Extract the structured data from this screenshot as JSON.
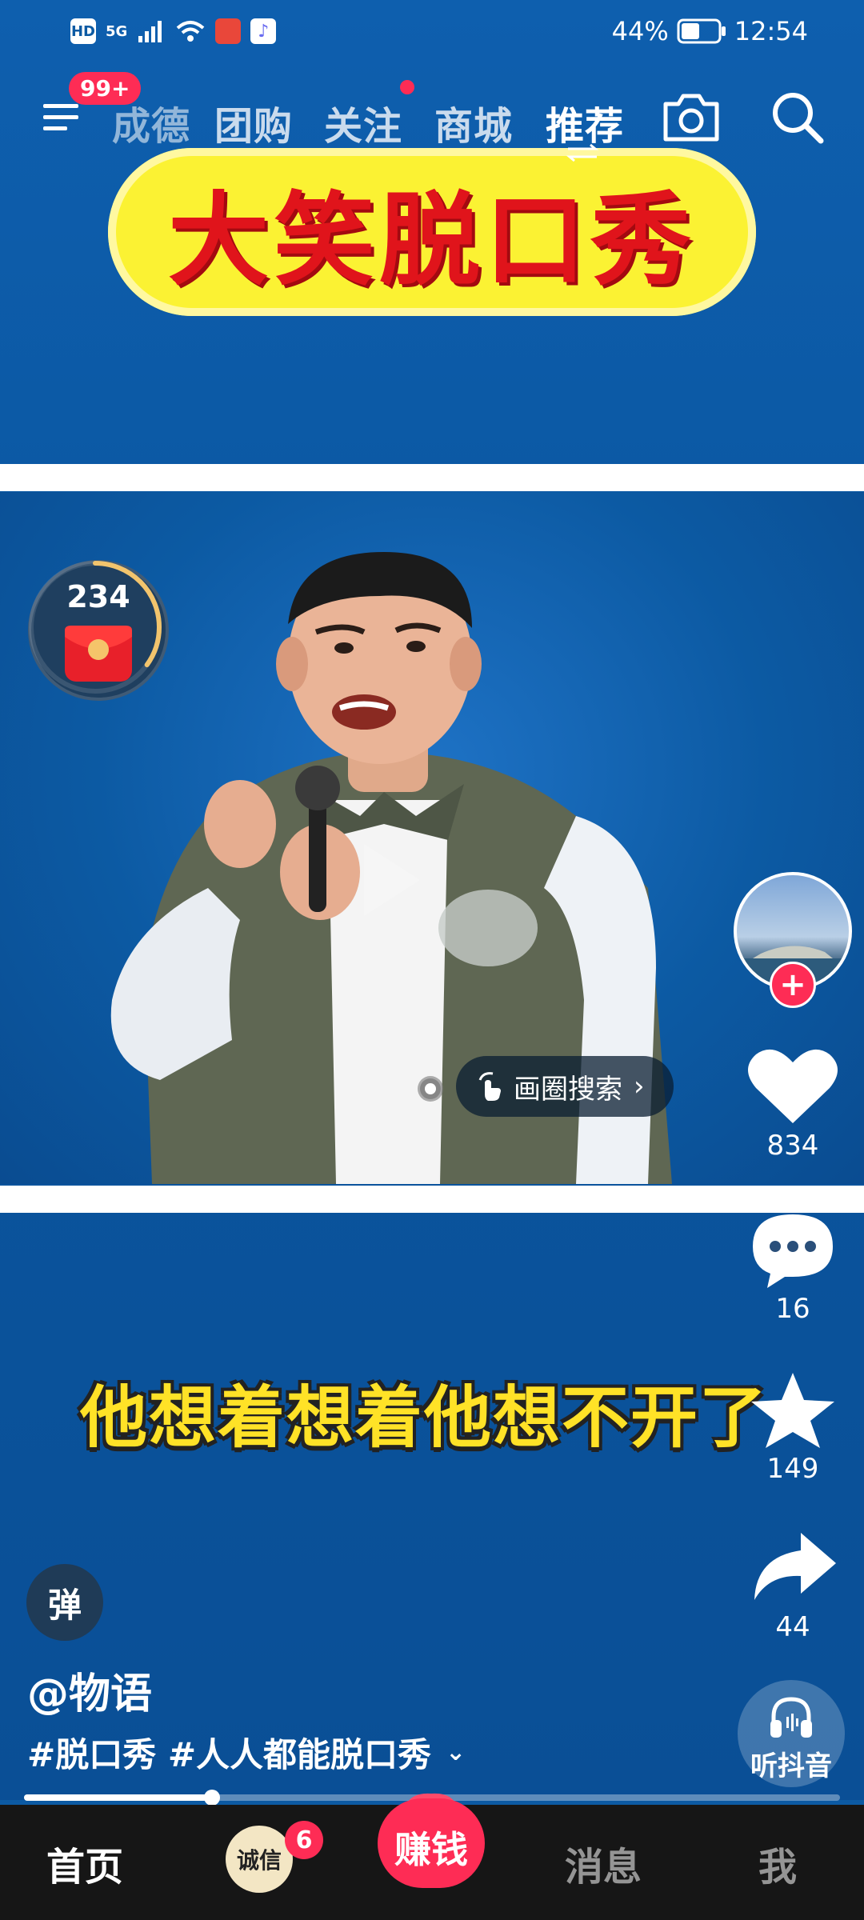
{
  "status_bar": {
    "hd_label": "HD",
    "signal_label": "5G",
    "battery_percent": "44%",
    "time": "12:54"
  },
  "top_nav": {
    "menu_badge": "99+",
    "tabs": [
      {
        "label": "成德"
      },
      {
        "label": "团购"
      },
      {
        "label": "关注"
      },
      {
        "label": "商城"
      },
      {
        "label": "推荐"
      }
    ]
  },
  "video": {
    "title_sticker": "大笑脱口秀",
    "subtitle": "他想着想着他想不开了",
    "circle_search_label": "画圈搜索"
  },
  "red_envelope": {
    "count": "234",
    "progress_fraction": 0.35
  },
  "actions": {
    "likes": "834",
    "comments": "16",
    "favorites": "149",
    "shares": "44"
  },
  "post": {
    "danmu_label": "弹",
    "author": "@物语",
    "hashtags": "#脱口秀 #人人都能脱口秀",
    "progress_fraction": 0.23
  },
  "listen": {
    "label": "听抖音"
  },
  "bottom_tabs": {
    "home": "首页",
    "friend_badge": "6",
    "friend_avatar_text": "诚信",
    "earn": "赚钱",
    "messages": "消息",
    "me": "我"
  },
  "colors": {
    "accent": "#fe2c55",
    "video_bg": "#0c5aa3",
    "subtitle_yellow": "#ffe227",
    "sticker_yellow": "#fbf233",
    "sticker_red": "#e0141b"
  }
}
